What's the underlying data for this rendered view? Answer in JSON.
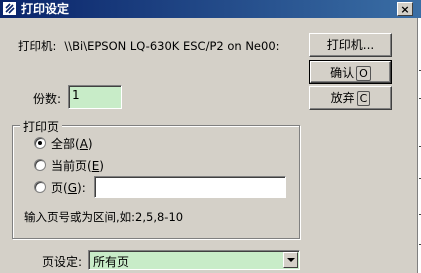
{
  "window": {
    "title": "打印设定",
    "close_glyph": "×"
  },
  "printer": {
    "label": "打印机:",
    "name": "\\\\Bi\\EPSON LQ-630K ESC/P2 on Ne00:"
  },
  "buttons": {
    "printer": "打印机...",
    "ok": {
      "label": "确认",
      "key": "O"
    },
    "cancel": {
      "label": "放弃",
      "key": "C"
    }
  },
  "copies": {
    "label": "份数:",
    "value": "1"
  },
  "print_range": {
    "group_label": "打印页",
    "all": {
      "label": "全部",
      "key": "A",
      "selected": true
    },
    "current": {
      "label": "当前页",
      "key": "E",
      "selected": false
    },
    "pages": {
      "label": "页",
      "key": "G",
      "value": ""
    },
    "hint": "输入页号或为区间,如:2,5,8-10"
  },
  "page_setting": {
    "label": "页设定:",
    "value": "所有页"
  }
}
